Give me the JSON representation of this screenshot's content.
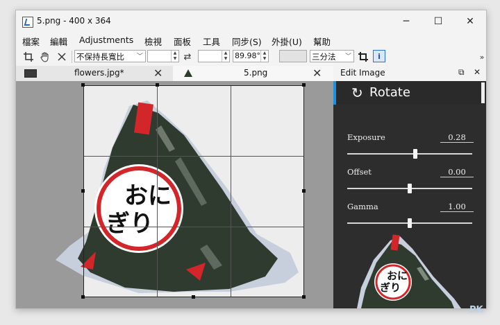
{
  "window": {
    "title": "5.png  - 400 x 364",
    "minimize_glyph": "─",
    "maximize_glyph": "☐",
    "close_glyph": "✕"
  },
  "menu": [
    "檔案",
    "編輯",
    "Adjustments",
    "檢視",
    "面板",
    "工具",
    "同步(S)",
    "外掛(U)",
    "幫助"
  ],
  "toolbar": {
    "aspect_select": "不保持長寬比",
    "width_value": "",
    "height_value": "",
    "angle_value": "89.98°",
    "grid_select": "三分法",
    "swap_glyph": "⇄",
    "info_label": "i",
    "overflow_glyph": "»"
  },
  "tabs": [
    {
      "label": "flowers.jpg*",
      "active": false
    },
    {
      "label": "5.png",
      "active": true
    }
  ],
  "panel": {
    "title": "Edit Image",
    "section": "Rotate",
    "params": [
      {
        "label": "Exposure",
        "value": "0.28",
        "fraction": 0.55
      },
      {
        "label": "Offset",
        "value": "0.00",
        "fraction": 0.5
      },
      {
        "label": "Gamma",
        "value": "1.00",
        "fraction": 0.5
      }
    ]
  },
  "image": {
    "kana_line1": "おに",
    "kana_line2": "ぎり"
  },
  "watermark": "PK"
}
